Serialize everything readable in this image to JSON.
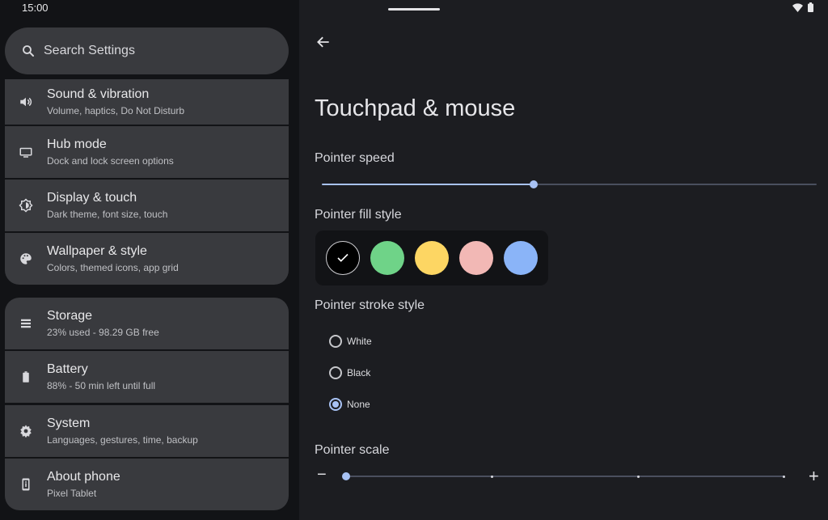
{
  "status_bar": {
    "time": "15:00",
    "icons": [
      "wifi-icon",
      "battery-icon"
    ]
  },
  "search": {
    "placeholder": "Search Settings",
    "icon": "search-icon"
  },
  "settings_list": {
    "group1": [
      {
        "title": "Sound & vibration",
        "subtitle": "Volume, haptics, Do Not Disturb",
        "icon": "volume-icon"
      },
      {
        "title": "Hub mode",
        "subtitle": "Dock and lock screen options",
        "icon": "monitor-icon"
      },
      {
        "title": "Display & touch",
        "subtitle": "Dark theme, font size, touch",
        "icon": "brightness-icon"
      },
      {
        "title": "Wallpaper & style",
        "subtitle": "Colors, themed icons, app grid",
        "icon": "palette-icon"
      }
    ],
    "group2": [
      {
        "title": "Storage",
        "subtitle": "23% used - 98.29 GB free",
        "icon": "storage-icon"
      },
      {
        "title": "Battery",
        "subtitle": "88% - 50 min left until full",
        "icon": "battery-icon"
      },
      {
        "title": "System",
        "subtitle": "Languages, gestures, time, backup",
        "icon": "gear-icon"
      },
      {
        "title": "About phone",
        "subtitle": "Pixel Tablet",
        "icon": "phone-info-icon"
      }
    ]
  },
  "detail": {
    "title": "Touchpad & mouse",
    "pointer_speed": {
      "label": "Pointer speed",
      "value_fraction": 0.43
    },
    "pointer_fill": {
      "label": "Pointer fill style",
      "swatches": [
        "#000000",
        "#6fd388",
        "#fdd663",
        "#f2b8b5",
        "#8ab4f8"
      ],
      "selected_index": 0
    },
    "pointer_stroke": {
      "label": "Pointer stroke style",
      "options": [
        "White",
        "Black",
        "None"
      ],
      "selected": "None"
    },
    "pointer_scale": {
      "label": "Pointer scale",
      "minus": "−",
      "plus": "+",
      "step": 0,
      "steps": 4
    }
  },
  "colors": {
    "accent": "#a8c2f4",
    "card": "#393a3e",
    "pane": "#121316",
    "background": "#1c1d21"
  }
}
